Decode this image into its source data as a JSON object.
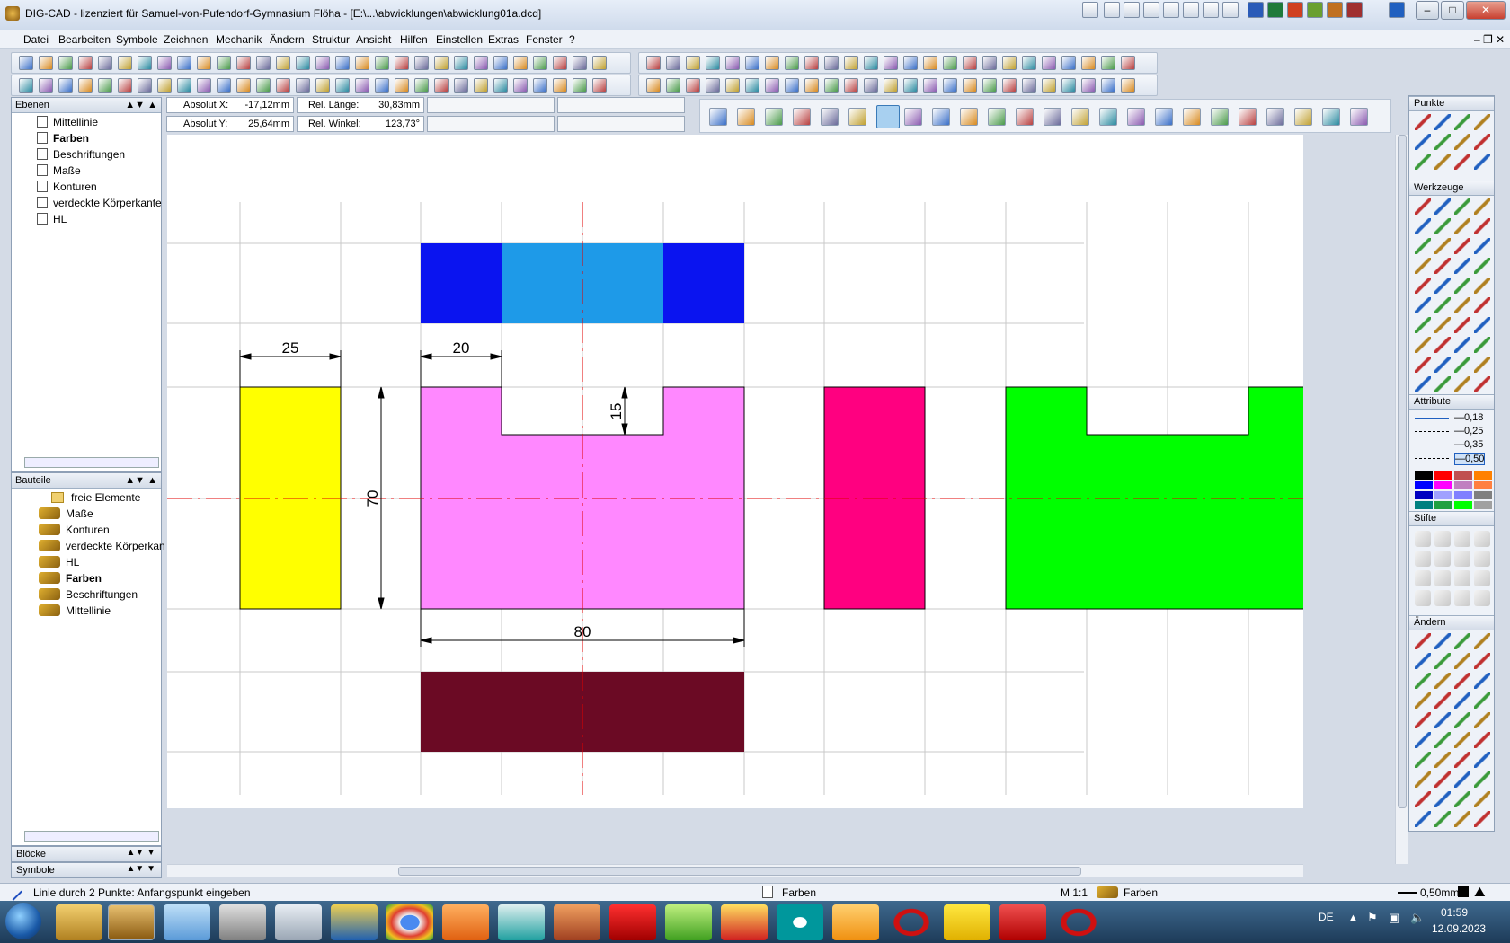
{
  "window": {
    "title": "DIG-CAD - lizenziert für Samuel-von-Pufendorf-Gymnasium Flöha - [E:\\...\\abwicklungen\\abwicklung01a.dcd]"
  },
  "menu": [
    "Datei",
    "Bearbeiten",
    "Symbole",
    "Zeichnen",
    "Mechanik",
    "Ändern",
    "Struktur",
    "Ansicht",
    "Hilfen",
    "Einstellen",
    "Extras",
    "Fenster",
    "?"
  ],
  "coords": {
    "abs_x_label": "Absolut X:",
    "abs_x": "-17,12mm",
    "abs_y_label": "Absolut Y:",
    "abs_y": "25,64mm",
    "rel_len_label": "Rel. Länge:",
    "rel_len": "30,83mm",
    "rel_angle_label": "Rel. Winkel:",
    "rel_angle": "123,73°"
  },
  "layers": {
    "header": "Ebenen",
    "items": [
      {
        "label": "Mittellinie",
        "bold": false
      },
      {
        "label": "Farben",
        "bold": true
      },
      {
        "label": "Beschriftungen",
        "bold": false
      },
      {
        "label": "Maße",
        "bold": false
      },
      {
        "label": "Konturen",
        "bold": false
      },
      {
        "label": "verdeckte Körperkante",
        "bold": false
      },
      {
        "label": "HL",
        "bold": false
      }
    ]
  },
  "parts": {
    "header": "Bauteile",
    "items": [
      {
        "label": "freie Elemente",
        "bold": false,
        "icon": "folder-icon"
      },
      {
        "label": "Maße",
        "bold": false,
        "icon": "part-icon"
      },
      {
        "label": "Konturen",
        "bold": false,
        "icon": "part-icon"
      },
      {
        "label": "verdeckte Körperkan",
        "bold": false,
        "icon": "part-icon"
      },
      {
        "label": "HL",
        "bold": false,
        "icon": "part-icon"
      },
      {
        "label": "Farben",
        "bold": true,
        "icon": "part-icon"
      },
      {
        "label": "Beschriftungen",
        "bold": false,
        "icon": "part-icon"
      },
      {
        "label": "Mittellinie",
        "bold": false,
        "icon": "part-icon"
      }
    ]
  },
  "bottom_panels": {
    "bloecke": "Blöcke",
    "symbole": "Symbole"
  },
  "drawing": {
    "dims": {
      "d25": "25",
      "d20": "20",
      "d15": "15",
      "d70": "70",
      "d80": "80"
    },
    "colors": {
      "blue": "#0a14f0",
      "lightblue": "#1e9ae8",
      "yellow": "#ffff00",
      "pink": "#ff88ff",
      "magenta": "#ff0080",
      "green": "#00ff00",
      "darkred": "#6b0a24",
      "centerline": "#e00000"
    }
  },
  "right_panel": {
    "punkte": "Punkte",
    "werkzeuge": "Werkzeuge",
    "attribute": "Attribute",
    "line_widths": [
      "0,18",
      "0,25",
      "0,35",
      "0,50"
    ],
    "stifte": "Stifte",
    "aendern": "Ändern",
    "palette": [
      "#000000",
      "#ff0000",
      "#c05050",
      "#ff8000",
      "#0000ff",
      "#ff00ff",
      "#c080c0",
      "#ff8040",
      "#0000c0",
      "#a0a0ff",
      "#8080ff",
      "#808080",
      "#008080",
      "#20a040",
      "#00ff00",
      "#a0a0a0"
    ]
  },
  "status": {
    "message": "Linie durch 2 Punkte: Anfangspunkt eingeben",
    "layer": "Farben",
    "scale": "M 1:1",
    "part": "Farben",
    "pen": "0,50mm"
  },
  "taskbar": {
    "lang": "DE",
    "time": "01:59",
    "date": "12.09.2023"
  }
}
